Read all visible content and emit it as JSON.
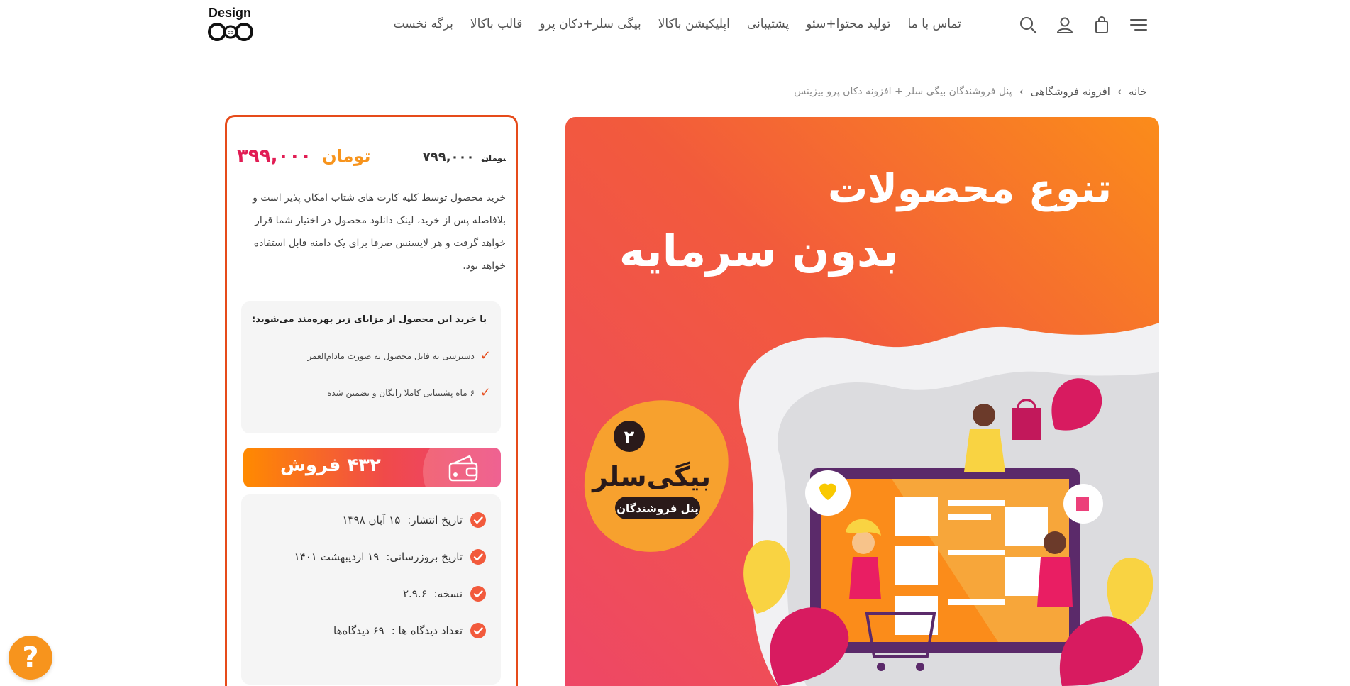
{
  "logo": {
    "text": "Design",
    "mark_text": "co"
  },
  "nav": {
    "items": [
      {
        "label": "برگه نخست"
      },
      {
        "label": "قالب باکالا"
      },
      {
        "label": "بیگی سلر+دکان پرو"
      },
      {
        "label": "اپلیکیشن باکالا"
      },
      {
        "label": "پشتیبانی"
      },
      {
        "label": "تولید محتوا+سئو"
      },
      {
        "label": "تماس با ما"
      }
    ]
  },
  "header_icons": [
    "menu-icon",
    "cart-icon",
    "user-icon",
    "search-icon"
  ],
  "breadcrumb": {
    "home": "خانه",
    "category": "افزونه فروشگاهی",
    "current": "پنل فروشندگان بیگی سلر + افزونه دکان پرو بیزینس",
    "separator": "‹"
  },
  "product": {
    "image_title_line1": "تنوع محصولات",
    "image_title_line2": "بدون سرمایه",
    "badge_number": "۲",
    "badge_title": "بیگی‌سلر",
    "badge_subtitle": "پنل فروشندگان"
  },
  "price": {
    "old_value": "۷۹۹,۰۰۰",
    "old_currency": "تومان",
    "new_value": "۳۹۹,۰۰۰",
    "new_currency": "تومان"
  },
  "description": "خرید محصول توسط کلیه کارت های شتاب امکان پذیر است و بلافاصله پس از خرید، لینک دانلود محصول در اختیار شما قرار خواهد گرفت و هر لایسنس صرفا برای یک دامنه قابل استفاده خواهد بود.",
  "benefits": {
    "title": "با خرید این محصول از مزایای زیر بهره‌مند می‌شوید:",
    "items": [
      {
        "text": "دسترسی به فایل محصول به صورت مادام‌العمر"
      },
      {
        "text": "۶ ماه پشتیبانی کاملا رایگان و تضمین شده"
      }
    ]
  },
  "sales": {
    "count": "۴۳۲",
    "label": "فروش"
  },
  "meta": {
    "rows": [
      {
        "label": "تاریخ انتشار:",
        "value": "۱۵ آبان ۱۳۹۸"
      },
      {
        "label": "تاریخ بروزرسانی:",
        "value": "۱۹ اردیبهشت ۱۴۰۱"
      },
      {
        "label": "نسخه:",
        "value": "۲.۹.۶"
      },
      {
        "label": "تعداد دیدگاه ها :",
        "value": "۶۹ دیدگاه‌ها"
      }
    ]
  },
  "help": {
    "label": "?"
  },
  "colors": {
    "accent_orange": "#f7941d",
    "accent_red": "#e64b1a",
    "price_pink": "#e11d54",
    "gradient_start": "#ff8a00",
    "gradient_end": "#ec407a"
  }
}
